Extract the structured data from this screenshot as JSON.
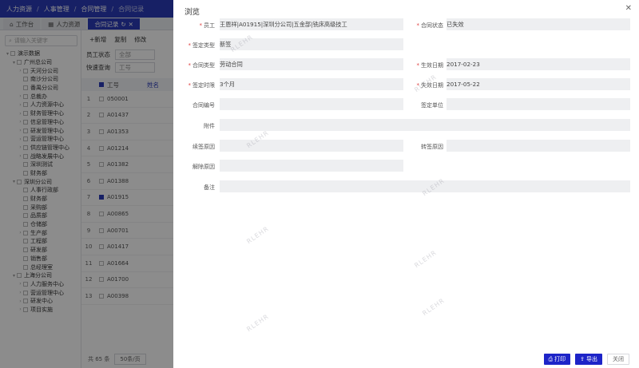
{
  "topbar": {
    "crumbs": [
      "人力资源",
      "人事管理",
      "合同管理",
      "合同记录"
    ]
  },
  "tabs": [
    "工作台",
    "人力资源",
    "合同记录"
  ],
  "sidebar": {
    "search_placeholder": "请输入关键字",
    "tree": [
      {
        "label": "演示数据",
        "level": 0,
        "arrow": "▾"
      },
      {
        "label": "广州总公司",
        "level": 1,
        "arrow": "▾"
      },
      {
        "label": "天河分公司",
        "level": 2,
        "arrow": "›"
      },
      {
        "label": "南沙分公司",
        "level": 2,
        "arrow": ""
      },
      {
        "label": "番禺分公司",
        "level": 2,
        "arrow": ""
      },
      {
        "label": "总裁办",
        "level": 2,
        "arrow": "›"
      },
      {
        "label": "人力资源中心",
        "level": 2,
        "arrow": "›"
      },
      {
        "label": "财务管理中心",
        "level": 2,
        "arrow": "›"
      },
      {
        "label": "信息管理中心",
        "level": 2,
        "arrow": "›"
      },
      {
        "label": "研发管理中心",
        "level": 2,
        "arrow": "›"
      },
      {
        "label": "营运管理中心",
        "level": 2,
        "arrow": "›"
      },
      {
        "label": "供应链管理中心",
        "level": 2,
        "arrow": "›"
      },
      {
        "label": "战略发展中心",
        "level": 2,
        "arrow": "›"
      },
      {
        "label": "深圳测试",
        "level": 2,
        "arrow": ""
      },
      {
        "label": "财务部",
        "level": 2,
        "arrow": ""
      },
      {
        "label": "深圳分公司",
        "level": 1,
        "arrow": "▾"
      },
      {
        "label": "人事行政部",
        "level": 2,
        "arrow": ""
      },
      {
        "label": "财务部",
        "level": 2,
        "arrow": ""
      },
      {
        "label": "采购部",
        "level": 2,
        "arrow": ""
      },
      {
        "label": "品质部",
        "level": 2,
        "arrow": ""
      },
      {
        "label": "仓储部",
        "level": 2,
        "arrow": ""
      },
      {
        "label": "生产部",
        "level": 2,
        "arrow": "›"
      },
      {
        "label": "工程部",
        "level": 2,
        "arrow": ""
      },
      {
        "label": "研发部",
        "level": 2,
        "arrow": ""
      },
      {
        "label": "销售部",
        "level": 2,
        "arrow": ""
      },
      {
        "label": "总经理室",
        "level": 2,
        "arrow": ""
      },
      {
        "label": "上海分公司",
        "level": 1,
        "arrow": "▾"
      },
      {
        "label": "人力服务中心",
        "level": 2,
        "arrow": "›"
      },
      {
        "label": "营运管理中心",
        "level": 2,
        "arrow": "›"
      },
      {
        "label": "研发中心",
        "level": 2,
        "arrow": "›"
      },
      {
        "label": "项目实施",
        "level": 2,
        "arrow": "›"
      }
    ]
  },
  "toolbar": {
    "add": "+新增",
    "copy": "复制",
    "edit": "修改"
  },
  "filters": {
    "status_label": "员工状态",
    "status_value": "全部",
    "quick_label": "快速查询",
    "quick_value": "工号"
  },
  "grid": {
    "header_no": "工号",
    "header_name": "姓名",
    "rows": [
      {
        "idx": "1",
        "no": "050001",
        "checked": false
      },
      {
        "idx": "2",
        "no": "A01437",
        "checked": false
      },
      {
        "idx": "3",
        "no": "A01353",
        "checked": false
      },
      {
        "idx": "4",
        "no": "A01214",
        "checked": false
      },
      {
        "idx": "5",
        "no": "A01382",
        "checked": false
      },
      {
        "idx": "6",
        "no": "A01388",
        "checked": false
      },
      {
        "idx": "7",
        "no": "A01915",
        "checked": true
      },
      {
        "idx": "8",
        "no": "A00865",
        "checked": false
      },
      {
        "idx": "9",
        "no": "A00701",
        "checked": false
      },
      {
        "idx": "10",
        "no": "A01417",
        "checked": false
      },
      {
        "idx": "11",
        "no": "A01664",
        "checked": false
      },
      {
        "idx": "12",
        "no": "A01700",
        "checked": false
      },
      {
        "idx": "13",
        "no": "A00398",
        "checked": false
      }
    ]
  },
  "pager": {
    "total": "共 65 条",
    "page_size": "50条/页"
  },
  "drawer": {
    "title": "浏览",
    "close": "✕",
    "fields": {
      "employee": {
        "label": "员工",
        "value": "王恩祥|A01915|深圳分公司|五金部|铣床高级技工",
        "required": true
      },
      "contract_status": {
        "label": "合同状态",
        "value": "已失效",
        "required": true
      },
      "sign_type": {
        "label": "签定类型",
        "value": "新签",
        "required": true
      },
      "contract_type": {
        "label": "合同类型",
        "value": "劳动合同",
        "required": true
      },
      "effective_date": {
        "label": "生效日期",
        "value": "2017-02-23",
        "required": true
      },
      "sign_period": {
        "label": "签定时限",
        "value": "3个月",
        "required": true
      },
      "expiry_date": {
        "label": "失效日期",
        "value": "2017-05-22",
        "required": true
      },
      "contract_no": {
        "label": "合同编号",
        "value": ""
      },
      "sign_unit": {
        "label": "签定单位",
        "value": ""
      },
      "attachment": {
        "label": "附件",
        "value": ""
      },
      "renew_reason": {
        "label": "续签原因",
        "value": ""
      },
      "transfer_reason": {
        "label": "转签原因",
        "value": ""
      },
      "terminate_reason": {
        "label": "解除原因",
        "value": ""
      },
      "remark": {
        "label": "备注",
        "value": ""
      }
    },
    "buttons": {
      "print": "打印",
      "export": "导出",
      "close": "关闭"
    }
  },
  "watermark": "RLEHR",
  "colors": {
    "brand": "#2a3bb8",
    "primary_button": "#1d24c8",
    "required": "#e04040"
  }
}
